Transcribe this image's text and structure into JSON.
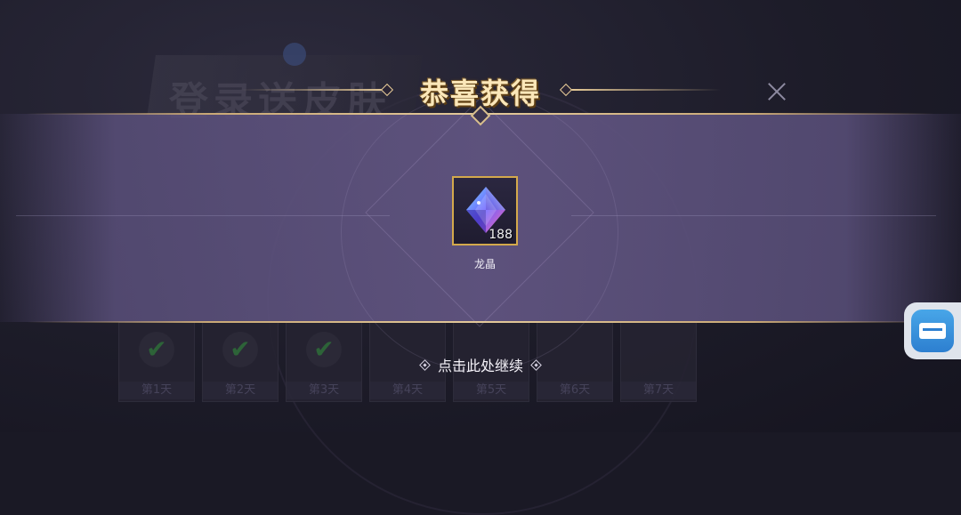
{
  "dialog": {
    "title": "恭喜获得",
    "continue_label": "点击此处继续"
  },
  "reward": {
    "name": "龙晶",
    "count": "188",
    "icon": "crystal-icon"
  },
  "background": {
    "banner_text": "登录送皮肤",
    "days": [
      {
        "label": "第1天",
        "claimed": true
      },
      {
        "label": "第2天",
        "claimed": true
      },
      {
        "label": "第3天",
        "claimed": true
      },
      {
        "label": "第4天",
        "claimed": false
      },
      {
        "label": "第5天",
        "claimed": false
      },
      {
        "label": "第6天",
        "claimed": false
      },
      {
        "label": "第7天",
        "claimed": false
      }
    ]
  },
  "colors": {
    "title_gold": "#fbe7b9",
    "item_border": "#d4a94c",
    "band_purple": "#605480"
  }
}
